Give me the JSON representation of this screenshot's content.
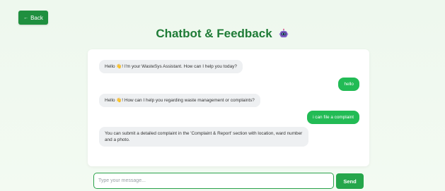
{
  "header": {
    "back_label": "Back",
    "title": "Chatbot & Feedback"
  },
  "messages": [
    {
      "sender": "bot",
      "text": "Hello 👋! I'm your WasteSys Assistant. How can I help you today?"
    },
    {
      "sender": "user",
      "text": "hello"
    },
    {
      "sender": "bot",
      "text": "Hello 👋! How can I help you regarding waste management or complaints?"
    },
    {
      "sender": "user",
      "text": "i can file a complaint"
    },
    {
      "sender": "bot",
      "text": "You can submit a detailed complaint in the 'Complaint & Report' section with location, ward number and a photo."
    }
  ],
  "composer": {
    "placeholder": "Type your message...",
    "send_label": "Send"
  },
  "colors": {
    "accent": "#1f8f3f",
    "user_bubble": "#22bb55",
    "bot_bubble": "#eef0f2"
  }
}
